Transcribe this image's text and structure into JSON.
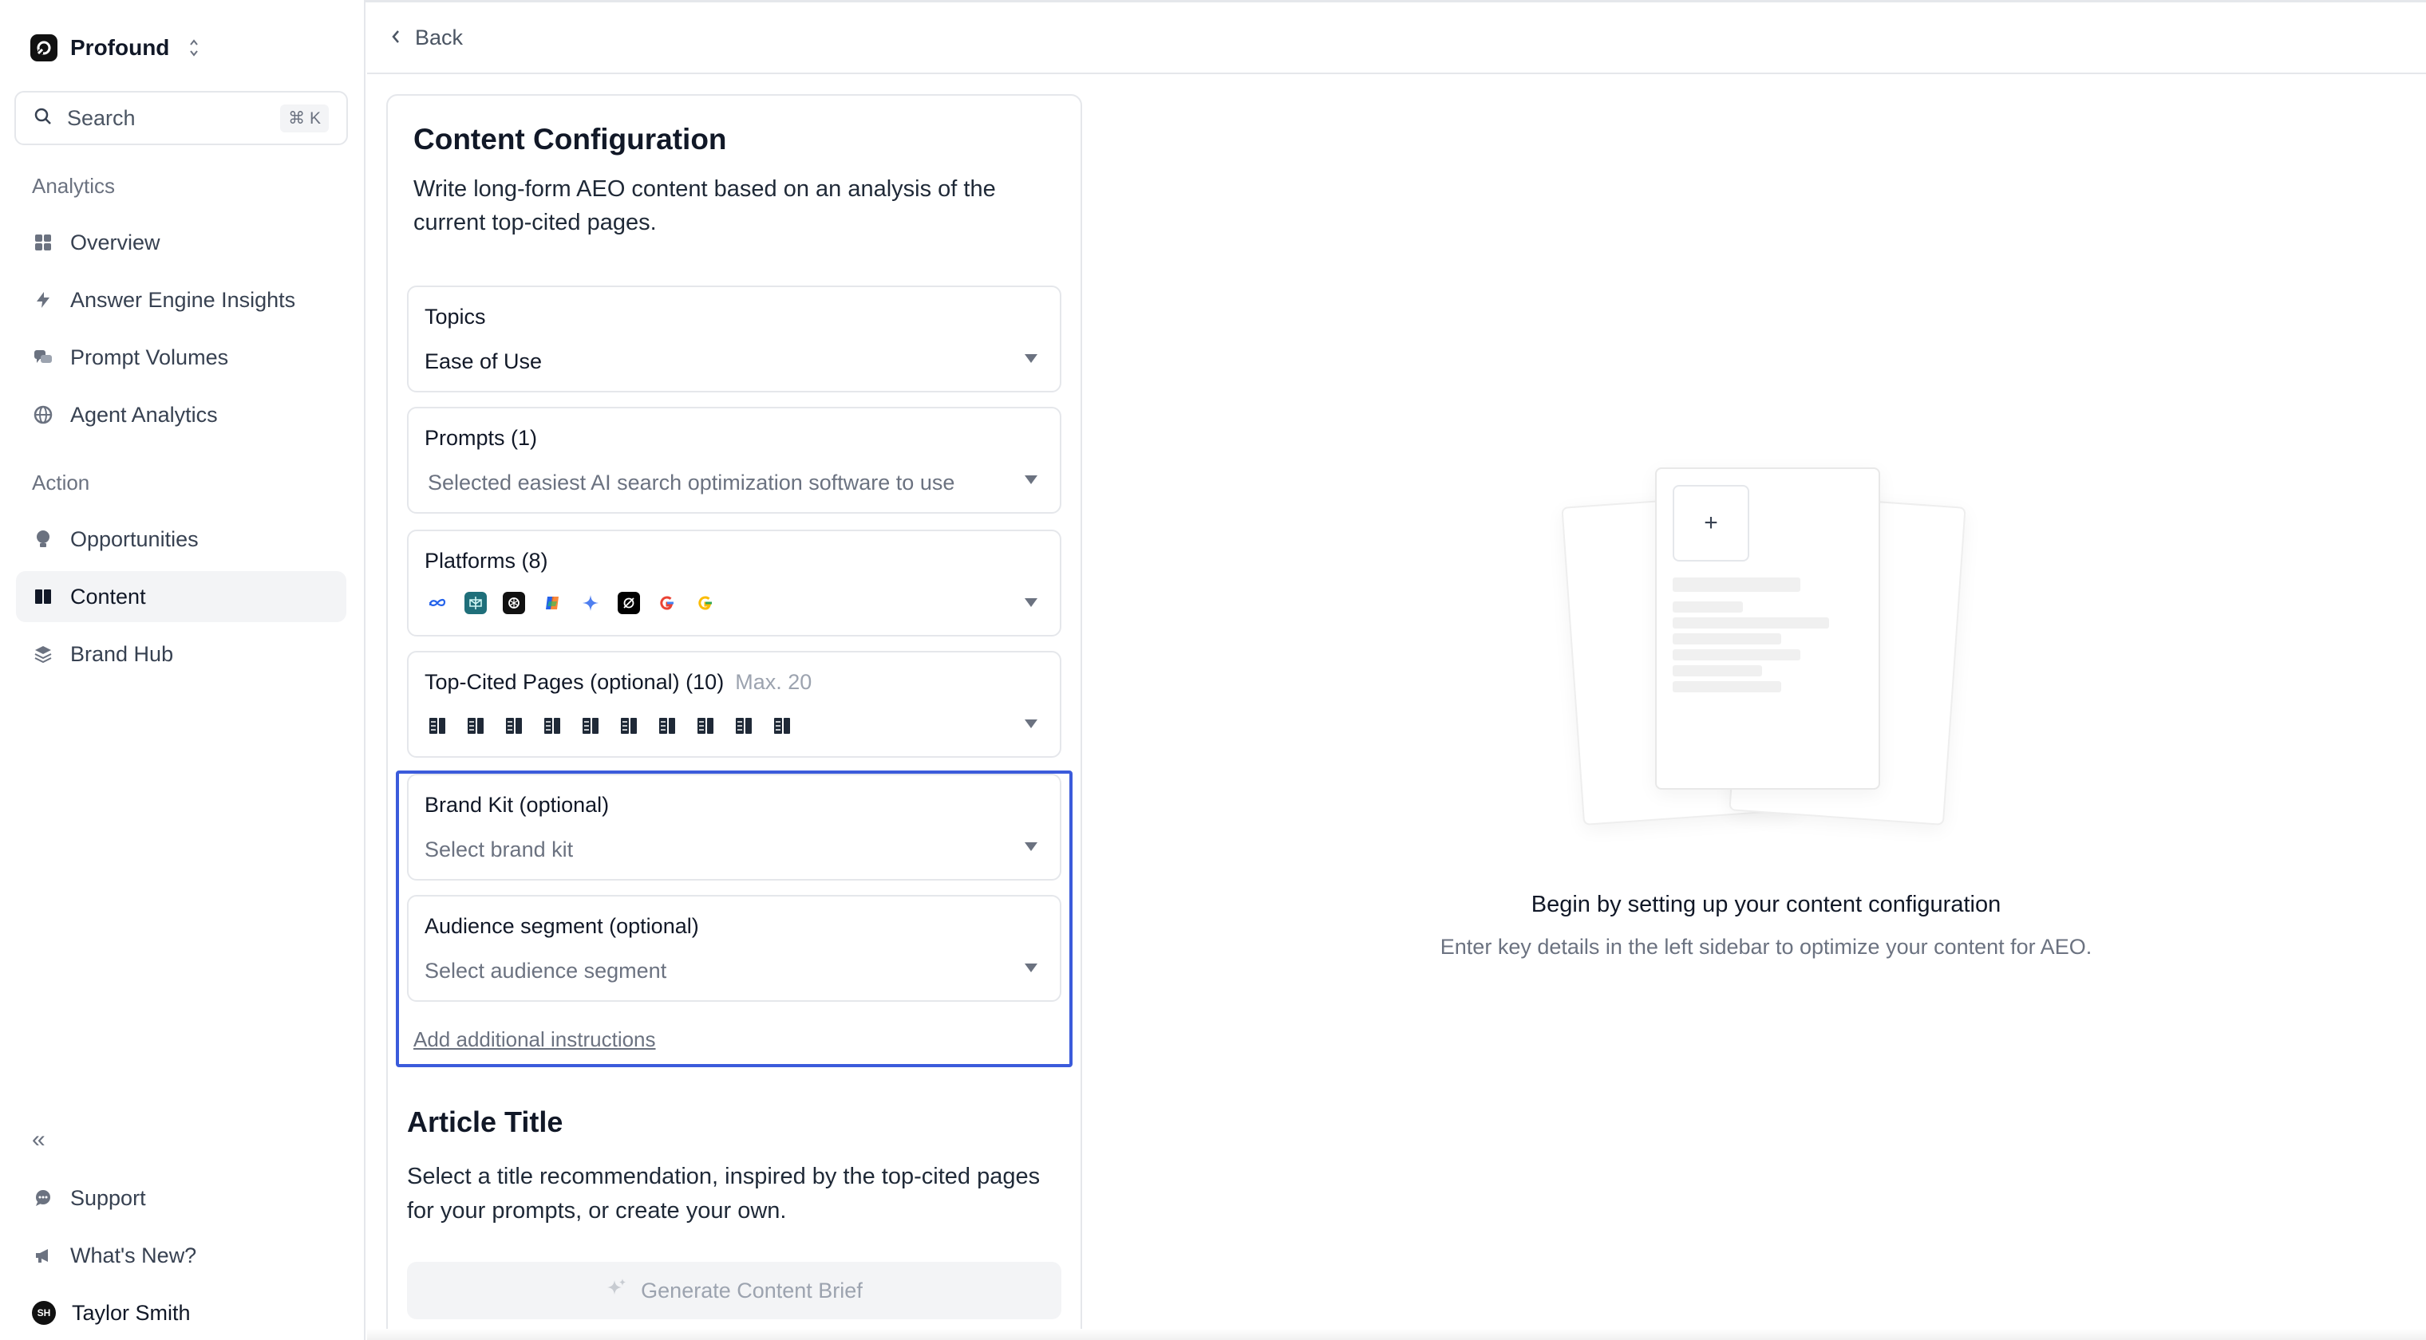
{
  "sidebar": {
    "workspace": "Profound",
    "search": {
      "label": "Search",
      "shortcut": "⌘ K"
    },
    "sections": {
      "analytics": "Analytics",
      "action": "Action"
    },
    "analytics_items": [
      {
        "label": "Overview",
        "icon": "grid-icon"
      },
      {
        "label": "Answer Engine Insights",
        "icon": "lightning-icon"
      },
      {
        "label": "Prompt Volumes",
        "icon": "chat-bubbles-icon"
      },
      {
        "label": "Agent Analytics",
        "icon": "globe-icon"
      }
    ],
    "action_items": [
      {
        "label": "Opportunities",
        "icon": "lightbulb-icon"
      },
      {
        "label": "Content",
        "icon": "book-icon",
        "active": true
      },
      {
        "label": "Brand Hub",
        "icon": "layers-icon"
      }
    ],
    "footer": {
      "collapse": "«",
      "support": "Support",
      "whats_new": "What's New?",
      "user": {
        "name": "Taylor Smith",
        "initials": "SH"
      }
    }
  },
  "header": {
    "back": "Back"
  },
  "config": {
    "title": "Content Configuration",
    "description": "Write long-form AEO content based on an analysis of the current top-cited pages.",
    "topics": {
      "label": "Topics",
      "value": "Ease of Use"
    },
    "prompts": {
      "label": "Prompts (1)",
      "value": "Selected easiest AI search optimization software to use"
    },
    "platforms": {
      "label": "Platforms (8)",
      "icons": [
        "meta-ai-icon",
        "perplexity-icon",
        "chatgpt-icon",
        "copilot-icon",
        "gemini-icon",
        "grok-icon",
        "google-icon",
        "google-ai-mode-icon"
      ]
    },
    "pages": {
      "label": "Top-Cited Pages (optional) (10)",
      "hint": "Max. 20",
      "count": 10
    },
    "brand_kit": {
      "label": "Brand Kit (optional)",
      "placeholder": "Select brand kit"
    },
    "audience": {
      "label": "Audience segment (optional)",
      "placeholder": "Select audience segment"
    },
    "add_instructions": "Add additional instructions",
    "article": {
      "title": "Article Title",
      "description": "Select a title recommendation, inspired by the top-cited pages for your prompts, or create your own."
    },
    "generate_button": "Generate Content Brief"
  },
  "empty_state": {
    "plus": "+",
    "title": "Begin by setting up your content configuration",
    "subtitle": "Enter key details in the left sidebar to optimize your content for AEO."
  },
  "colors": {
    "highlight": "#3b5bdb",
    "active_nav_bg": "#f3f4f6"
  }
}
